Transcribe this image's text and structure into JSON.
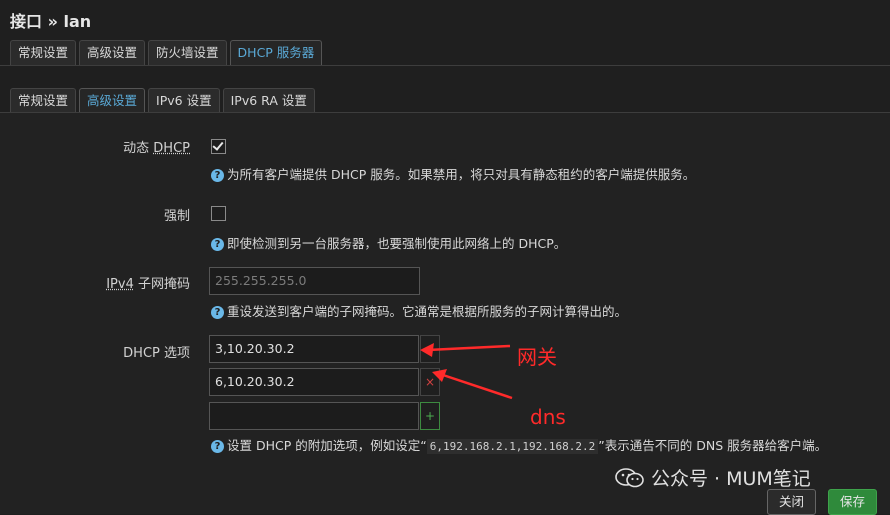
{
  "page": {
    "title": "接口 » lan"
  },
  "top_tabs": [
    "常规设置",
    "高级设置",
    "防火墙设置",
    "DHCP 服务器"
  ],
  "sub_tabs": [
    "常规设置",
    "高级设置",
    "IPv6 设置",
    "IPv6 RA 设置"
  ],
  "fields": {
    "dynamic_dhcp": {
      "label_prefix": "动态 ",
      "label_u": "DHCP",
      "checked": true,
      "help": "为所有客户端提供 DHCP 服务。如果禁用，将只对具有静态租约的客户端提供服务。"
    },
    "force": {
      "label": "强制",
      "checked": false,
      "help": "即使检测到另一台服务器，也要强制使用此网络上的 DHCP。"
    },
    "netmask": {
      "label_u": "IPv4",
      "label_suffix": " 子网掩码",
      "placeholder": "255.255.255.0",
      "help": "重设发送到客户端的子网掩码。它通常是根据所服务的子网计算得出的。"
    },
    "dhcp_options": {
      "label": "DHCP 选项",
      "values": [
        "3,10.20.30.2",
        "6,10.20.30.2",
        ""
      ],
      "help_prefix": "设置 DHCP 的附加选项，例如设定“",
      "help_code": "6,192.168.2.1,192.168.2.2",
      "help_suffix": "”表示通告不同的 DNS 服务器给客户端。"
    }
  },
  "annotations": {
    "gateway": "网关",
    "dns": "dns"
  },
  "watermark": "公众号 · MUM笔记",
  "buttons": {
    "close": "关闭",
    "save": "保存"
  },
  "glyphs": {
    "question": "?",
    "remove": "×",
    "add": "+"
  }
}
